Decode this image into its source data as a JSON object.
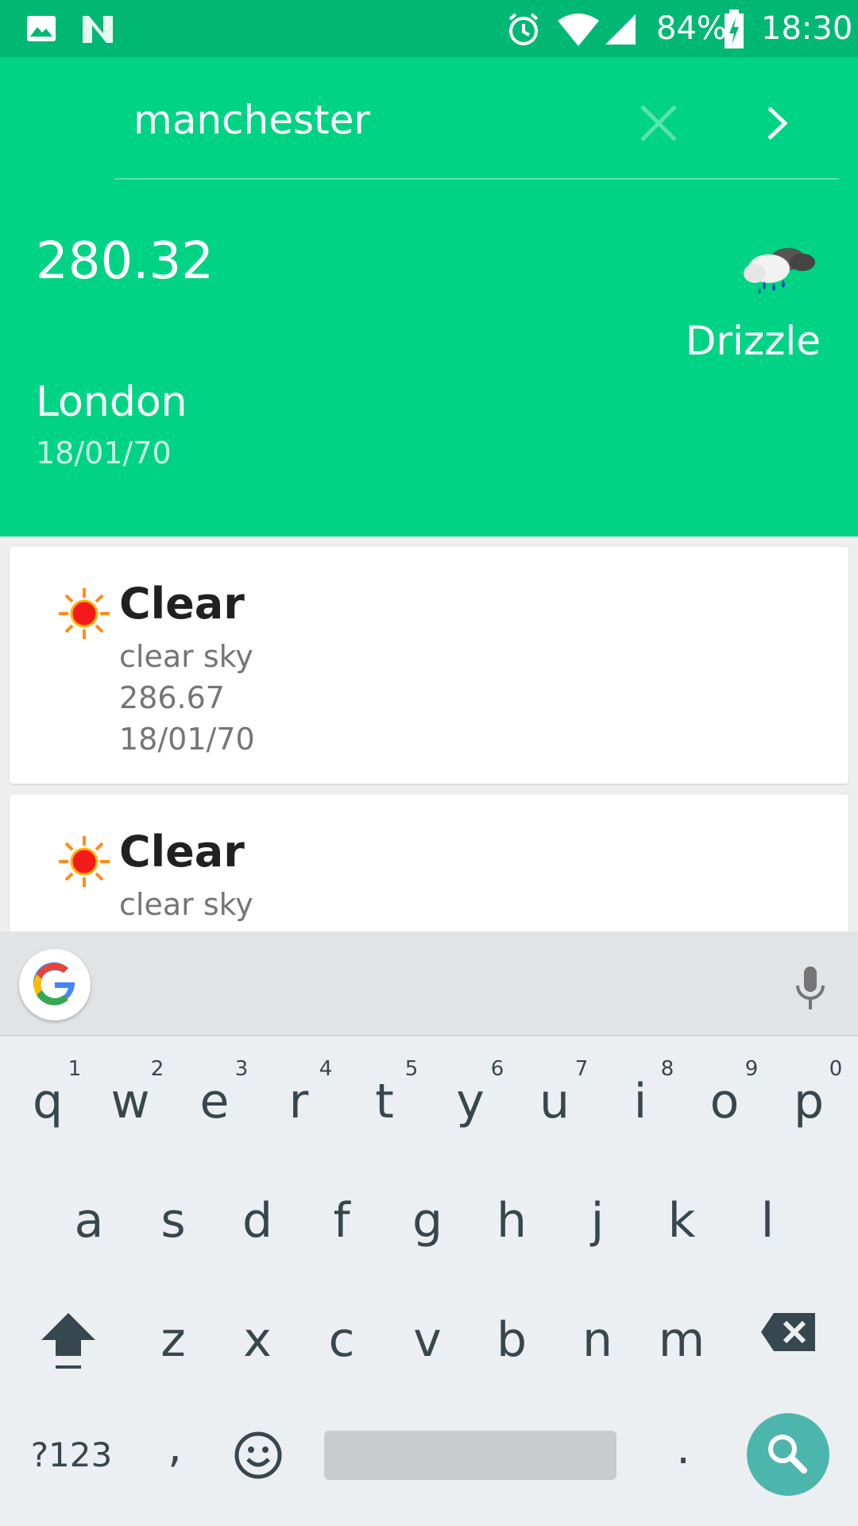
{
  "status_bar": {
    "battery": "84%",
    "time": "18:30"
  },
  "search": {
    "value": "manchester"
  },
  "current": {
    "temperature": "280.32",
    "condition": "Drizzle",
    "city": "London",
    "date": "18/01/70"
  },
  "forecast": [
    {
      "title": "Clear",
      "description": "clear sky",
      "temperature": "286.67",
      "date": "18/01/70",
      "icon": "sun-icon"
    },
    {
      "title": "Clear",
      "description": "clear sky",
      "temperature": "",
      "date": "",
      "icon": "sun-icon"
    }
  ],
  "keyboard": {
    "row1": [
      "q",
      "w",
      "e",
      "r",
      "t",
      "y",
      "u",
      "i",
      "o",
      "p"
    ],
    "row1_hints": [
      "1",
      "2",
      "3",
      "4",
      "5",
      "6",
      "7",
      "8",
      "9",
      "0"
    ],
    "row2": [
      "a",
      "s",
      "d",
      "f",
      "g",
      "h",
      "j",
      "k",
      "l"
    ],
    "row3": [
      "z",
      "x",
      "c",
      "v",
      "b",
      "n",
      "m"
    ],
    "symbols_label": "?123",
    "comma": ",",
    "period": "."
  },
  "colors": {
    "header": "#00d383",
    "status_bar": "#00b874",
    "search_key": "#4db6ac"
  }
}
